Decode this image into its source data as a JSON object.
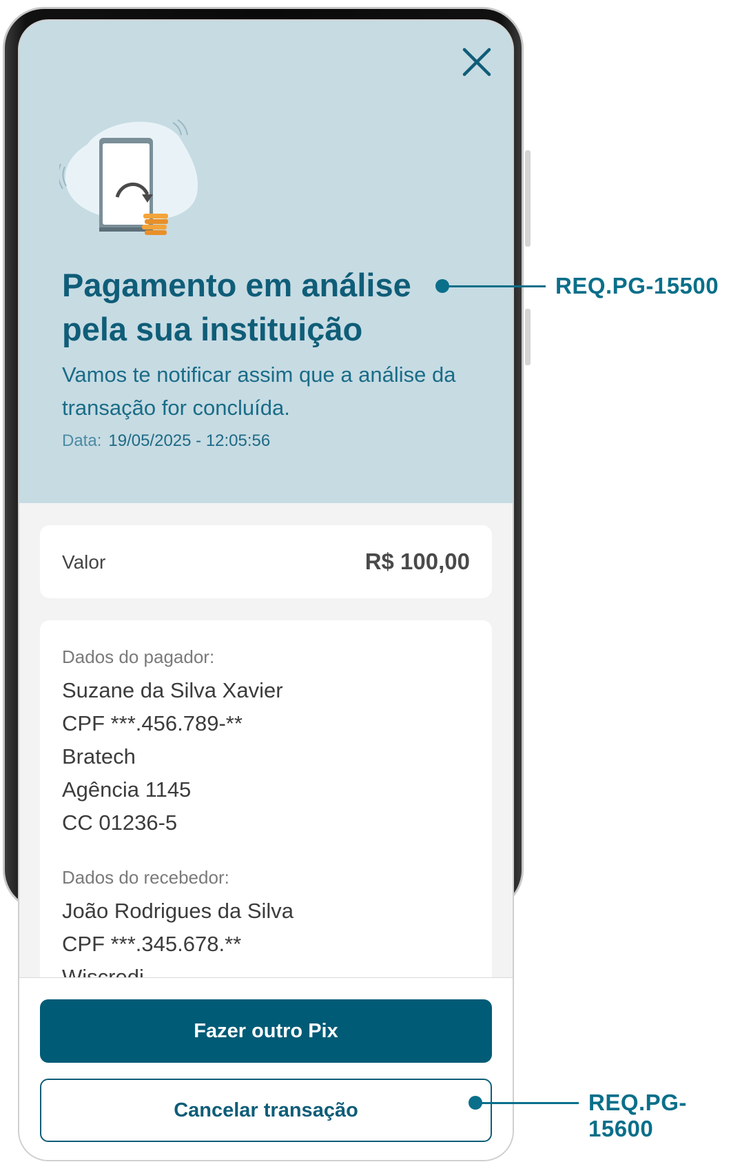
{
  "screen": {
    "title": "Pagamento em análise pela sua instituição",
    "subtitle": "Vamos te notificar assim que a análise da transação for concluída.",
    "date_label": "Data:",
    "date_value": "19/05/2025 - 12:05:56"
  },
  "value_card": {
    "label": "Valor",
    "amount": "R$ 100,00"
  },
  "payer": {
    "section_label": "Dados do pagador:",
    "name": "Suzane da Silva Xavier",
    "cpf": "CPF ***.456.789-**",
    "bank": "Bratech",
    "agency": "Agência 1145",
    "account": "CC 01236-5"
  },
  "receiver": {
    "section_label": "Dados do recebedor:",
    "name": "João Rodrigues da Silva",
    "cpf": "CPF ***.345.678.**",
    "bank_partial": "Wiscredi"
  },
  "actions": {
    "primary_label": "Fazer outro Pix",
    "secondary_label": "Cancelar transação"
  },
  "annotations": [
    {
      "label": "REQ.PG-15500"
    },
    {
      "label": "REQ.PG-15600"
    }
  ],
  "icons": {
    "close": "close-icon",
    "illustration": "phone-transfer-illustration"
  },
  "colors": {
    "hero_bg": "#c7dbe3",
    "primary": "#005b76",
    "title": "#0f5d78",
    "annotation": "#0a6f8a",
    "coins": "#f4a43a"
  }
}
